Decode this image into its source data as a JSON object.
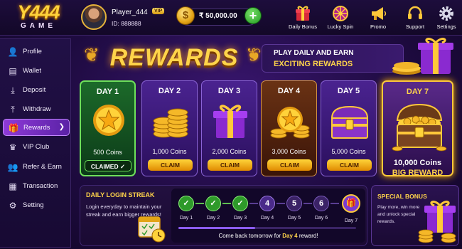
{
  "brand": {
    "line1": "Y444",
    "line2": "GAME"
  },
  "player": {
    "name": "Player_444",
    "badge": "VIP",
    "id": "ID: 888888"
  },
  "balance": {
    "value": "₹ 50,000.00"
  },
  "header_actions": [
    {
      "label": "Daily Bonus",
      "icon": "gift-icon"
    },
    {
      "label": "Lucky Spin",
      "icon": "wheel-icon"
    },
    {
      "label": "Promo",
      "icon": "megaphone-icon"
    },
    {
      "label": "Support",
      "icon": "headset-icon"
    },
    {
      "label": "Settings",
      "icon": "gear-icon"
    }
  ],
  "sidebar": {
    "items": [
      {
        "label": "Profile",
        "icon": "user-icon"
      },
      {
        "label": "Wallet",
        "icon": "wallet-icon"
      },
      {
        "label": "Deposit",
        "icon": "deposit-icon"
      },
      {
        "label": "Withdraw",
        "icon": "withdraw-icon"
      },
      {
        "label": "Rewards",
        "icon": "gift-icon",
        "active": true
      },
      {
        "label": "VIP Club",
        "icon": "crown-icon"
      },
      {
        "label": "Refer & Earn",
        "icon": "users-icon"
      },
      {
        "label": "Transaction",
        "icon": "document-icon"
      },
      {
        "label": "Setting",
        "icon": "gear-icon"
      }
    ]
  },
  "rewards": {
    "title": "REWARDS",
    "tagline1": "PLAY DAILY AND EARN",
    "tagline2": "EXCITING REWARDS",
    "days": [
      {
        "label": "DAY 1",
        "coins": "500 Coins",
        "button": "CLAIMED",
        "state": "claimed"
      },
      {
        "label": "DAY 2",
        "coins": "1,000 Coins",
        "button": "CLAIM",
        "state": "available"
      },
      {
        "label": "DAY 3",
        "coins": "2,000 Coins",
        "button": "CLAIM",
        "state": "available"
      },
      {
        "label": "DAY 4",
        "coins": "3,000 Coins",
        "button": "CLAIM",
        "state": "available"
      },
      {
        "label": "DAY 5",
        "coins": "5,000 Coins",
        "button": "CLAIM",
        "state": "available"
      },
      {
        "label": "DAY 7",
        "coins": "10,000 Coins",
        "extra": "BIG REWARD",
        "state": "big"
      }
    ]
  },
  "streak": {
    "title": "DAILY LOGIN STREAK",
    "description": "Login everyday to maintain your streak and earn bigger rewards!",
    "steps": [
      {
        "label": "Day 1",
        "mark": "✓",
        "state": "done"
      },
      {
        "label": "Day 2",
        "mark": "✓",
        "state": "done"
      },
      {
        "label": "Day 3",
        "mark": "✓",
        "state": "done"
      },
      {
        "label": "Day 4",
        "mark": "4",
        "state": "current"
      },
      {
        "label": "Day 5",
        "mark": "5",
        "state": "future"
      },
      {
        "label": "Day 6",
        "mark": "6",
        "state": "future"
      },
      {
        "label": "Day 7",
        "mark": "🎁",
        "state": "gift"
      }
    ],
    "progress": 0.43,
    "message_pre": "Come back tomorrow for ",
    "message_day": "Day 4",
    "message_post": " reward!"
  },
  "bonus": {
    "title": "SPECIAL BONUS",
    "description": "Play more, win more and unlock special rewards."
  },
  "colors": {
    "gold": "#ffd44a",
    "purple": "#8e3ad8",
    "green": "#2e9a2a"
  }
}
